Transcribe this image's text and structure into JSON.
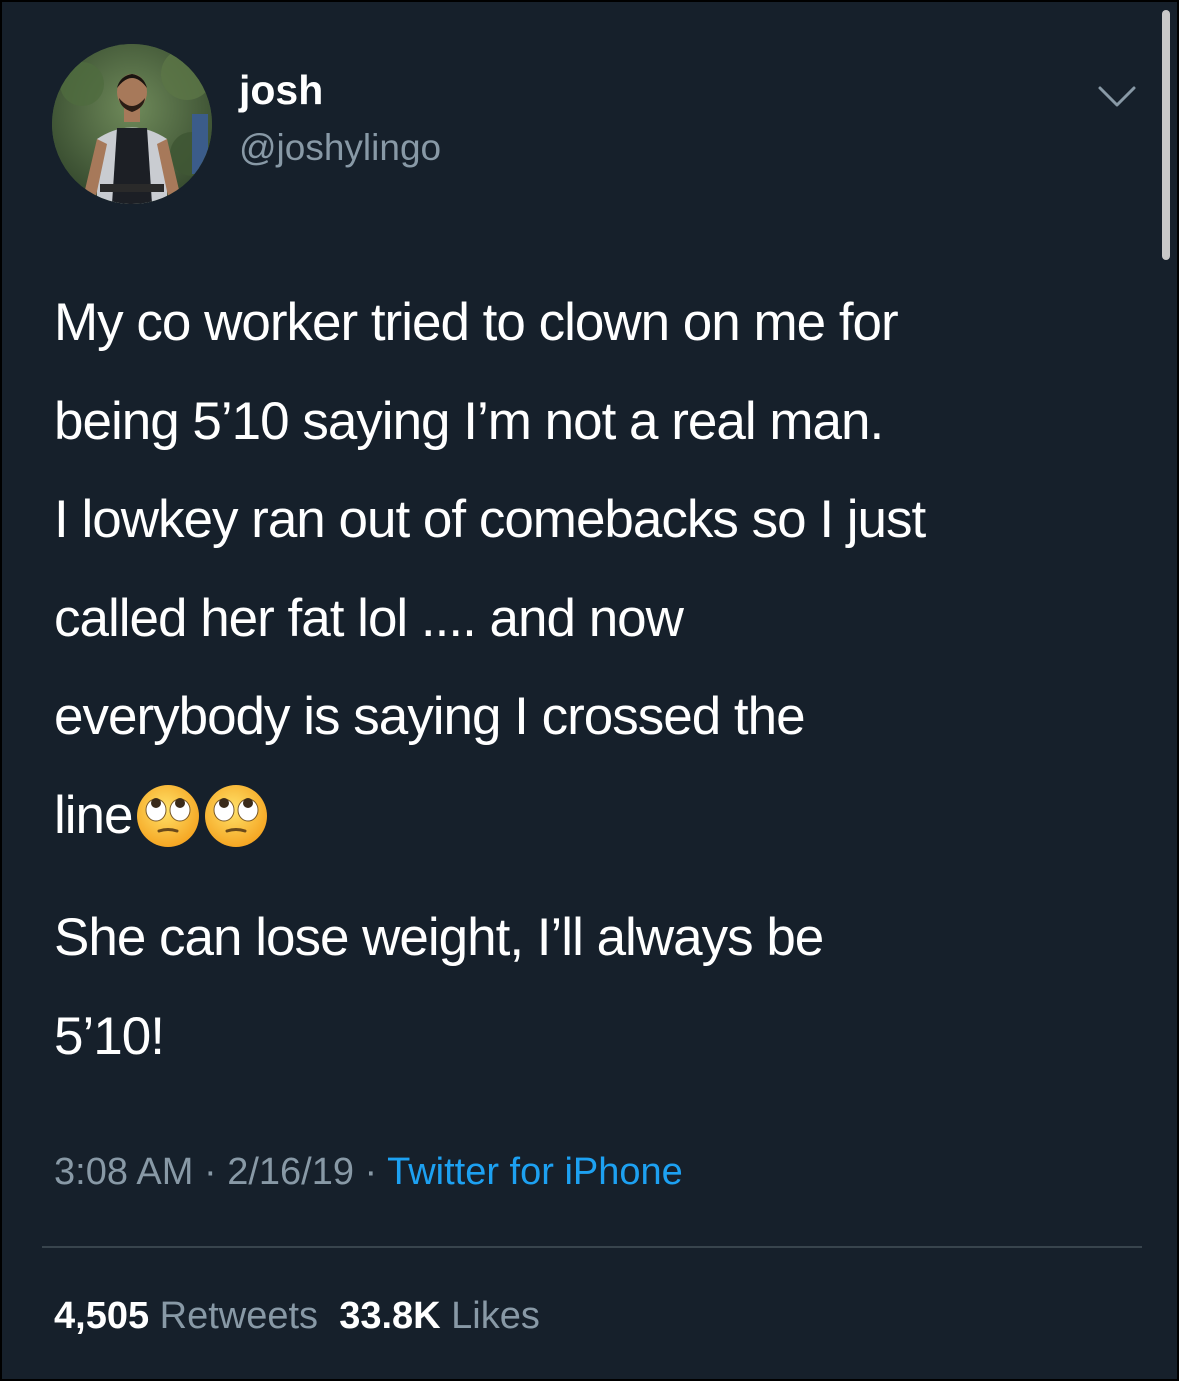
{
  "user": {
    "display_name": "josh",
    "handle": "@joshylingo"
  },
  "tweet": {
    "lines": [
      "My co worker tried to clown on me for",
      "being 5’10 saying I’m not a real man.",
      "I lowkey ran out of comebacks so I just",
      "called her fat lol .... and now",
      "everybody is saying I crossed the",
      "line"
    ],
    "emojis": [
      "face-with-rolling-eyes",
      "face-with-rolling-eyes"
    ],
    "second_paragraph": [
      "She can lose weight, I’ll always be",
      "5’10!"
    ]
  },
  "meta": {
    "time": "3:08 AM",
    "separator": " · ",
    "date": "2/16/19",
    "source": "Twitter for iPhone"
  },
  "stats": {
    "retweets_count": "4,505",
    "retweets_label": "Retweets",
    "likes_count": "33.8K",
    "likes_label": "Likes"
  },
  "icons": {
    "menu": "chevron-down-icon",
    "emoji": "rolling-eyes-emoji"
  },
  "colors": {
    "background": "#16202b",
    "text": "#ffffff",
    "secondary": "#8899a6",
    "link": "#1da1f2"
  }
}
